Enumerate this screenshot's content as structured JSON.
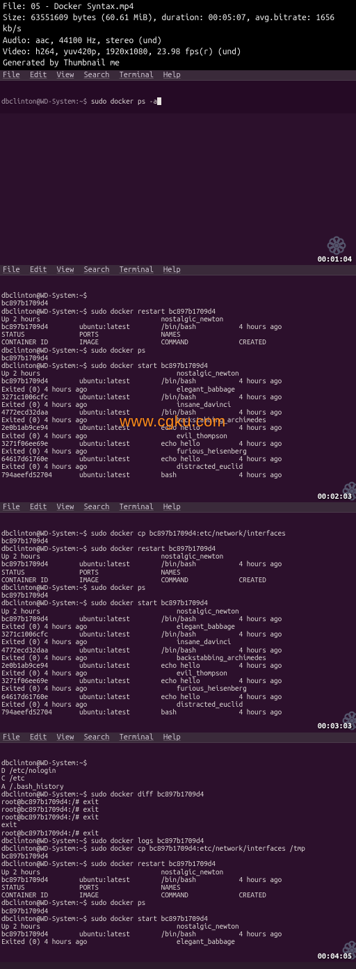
{
  "header": {
    "file": "File: 05 - Docker Syntax.mp4",
    "size": "Size: 63551609 bytes (60.61 MiB), duration: 00:05:07, avg.bitrate: 1656 kb/s",
    "audio": "Audio: aac, 44100 Hz, stereo (und)",
    "video": "Video: h264, yuv420p, 1920x1080, 23.98 fps(r) (und)",
    "gen": "Generated by Thumbnail me"
  },
  "menu": {
    "file": "File",
    "edit": "Edit",
    "view": "View",
    "search": "Search",
    "terminal": "Terminal",
    "help": "Help"
  },
  "watermark": "www.cgku.com",
  "ts": {
    "a": "00:01:04",
    "b": "00:02:03",
    "c": "00:03:03",
    "d": "00:04:05"
  },
  "panes": {
    "a": {
      "prompt": "dbclinton@WD-System:~$ ",
      "cmd": "sudo docker ps -a"
    },
    "b": [
      "794aeefd52704       ubuntu:latest        bash                4 hours ago",
      "Exited (0) 4 hours ago                       distracted_euclid",
      "64617d61760e        ubuntu:latest        echo hello          4 hours ago",
      "Exited (0) 4 hours ago                       furious_heisenberg",
      "3271f06ee69e        ubuntu:latest        echo hello          4 hours ago",
      "Exited (0) 4 hours ago                       evil_thompson",
      "2e0b1ab9ce94        ubuntu:latest        echo hello          4 hours ago",
      "Exited (0) 4 hours ago                       backstabbing_archimedes",
      "4772ecd32daa        ubuntu:latest        /bin/bash           4 hours ago",
      "Exited (0) 4 hours ago                       insane_davinci",
      "3271c1006cfc        ubuntu:latest        /bin/bash           4 hours ago",
      "Exited (0) 4 hours ago                       elegant_babbage",
      "bc897b1709d4        ubuntu:latest        /bin/bash           4 hours ago",
      "Up 2 hours                                   nostalgic_newton",
      "dbclinton@WD-System:~$ sudo docker start bc897b1709d4",
      "bc897b1709d4",
      "dbclinton@WD-System:~$ sudo docker ps",
      "CONTAINER ID        IMAGE                COMMAND             CREATED",
      "STATUS              PORTS                NAMES",
      "bc897b1709d4        ubuntu:latest        /bin/bash           4 hours ago",
      "Up 2 hours                               nostalgic_newton",
      "dbclinton@WD-System:~$ sudo docker restart bc897b1709d4",
      "bc897b1709d4",
      "dbclinton@WD-System:~$ "
    ],
    "c": [
      "794aeefd52704       ubuntu:latest        bash                4 hours ago",
      "Exited (0) 4 hours ago                       distracted_euclid",
      "64617d61760e        ubuntu:latest        echo hello          4 hours ago",
      "Exited (0) 4 hours ago                       furious_heisenberg",
      "3271f06ee69e        ubuntu:latest        echo hello          4 hours ago",
      "Exited (0) 4 hours ago                       evil_thompson",
      "2e0b1ab9ce94        ubuntu:latest        echo hello          4 hours ago",
      "Exited (0) 4 hours ago                       backstabbing_archimedes",
      "4772ecd32daa        ubuntu:latest        /bin/bash           4 hours ago",
      "Exited (0) 4 hours ago                       insane_davinci",
      "3271c1006cfc        ubuntu:latest        /bin/bash           4 hours ago",
      "Exited (0) 4 hours ago                       elegant_babbage",
      "bc897b1709d4        ubuntu:latest        /bin/bash           4 hours ago",
      "Up 2 hours                                   nostalgic_newton",
      "dbclinton@WD-System:~$ sudo docker start bc897b1709d4",
      "bc897b1709d4",
      "dbclinton@WD-System:~$ sudo docker ps",
      "CONTAINER ID        IMAGE                COMMAND             CREATED",
      "STATUS              PORTS                NAMES",
      "bc897b1709d4        ubuntu:latest        /bin/bash           4 hours ago",
      "Up 2 hours                               nostalgic_newton",
      "dbclinton@WD-System:~$ sudo docker restart bc897b1709d4",
      "bc897b1709d4",
      "dbclinton@WD-System:~$ sudo docker cp bc897b1709d4:etc/network/interfaces "
    ],
    "d": [
      "Exited (0) 4 hours ago                       elegant_babbage",
      "bc897b1709d4        ubuntu:latest        /bin/bash           4 hours ago",
      "Up 2 hours                                   nostalgic_newton",
      "dbclinton@WD-System:~$ sudo docker start bc897b1709d4",
      "bc897b1709d4",
      "dbclinton@WD-System:~$ sudo docker ps",
      "CONTAINER ID        IMAGE                COMMAND             CREATED",
      "STATUS              PORTS                NAMES",
      "bc897b1709d4        ubuntu:latest        /bin/bash           4 hours ago",
      "Up 2 hours                               nostalgic_newton",
      "dbclinton@WD-System:~$ sudo docker restart bc897b1709d4",
      "bc897b1709d4",
      "dbclinton@WD-System:~$ sudo docker cp bc897b1709d4:etc/network/interfaces /tmp",
      "dbclinton@WD-System:~$ sudo docker logs bc897b1709d4",
      "root@bc897b1709d4:/# exit",
      "exit",
      "root@bc897b1709d4:/# exit",
      "root@bc897b1709d4:/# exit",
      "root@bc897b1709d4:/# exit",
      "dbclinton@WD-System:~$ sudo docker diff bc897b1709d4",
      "A /.bash_history",
      "C /etc",
      "D /etc/nologin",
      "dbclinton@WD-System:~$ "
    ]
  }
}
